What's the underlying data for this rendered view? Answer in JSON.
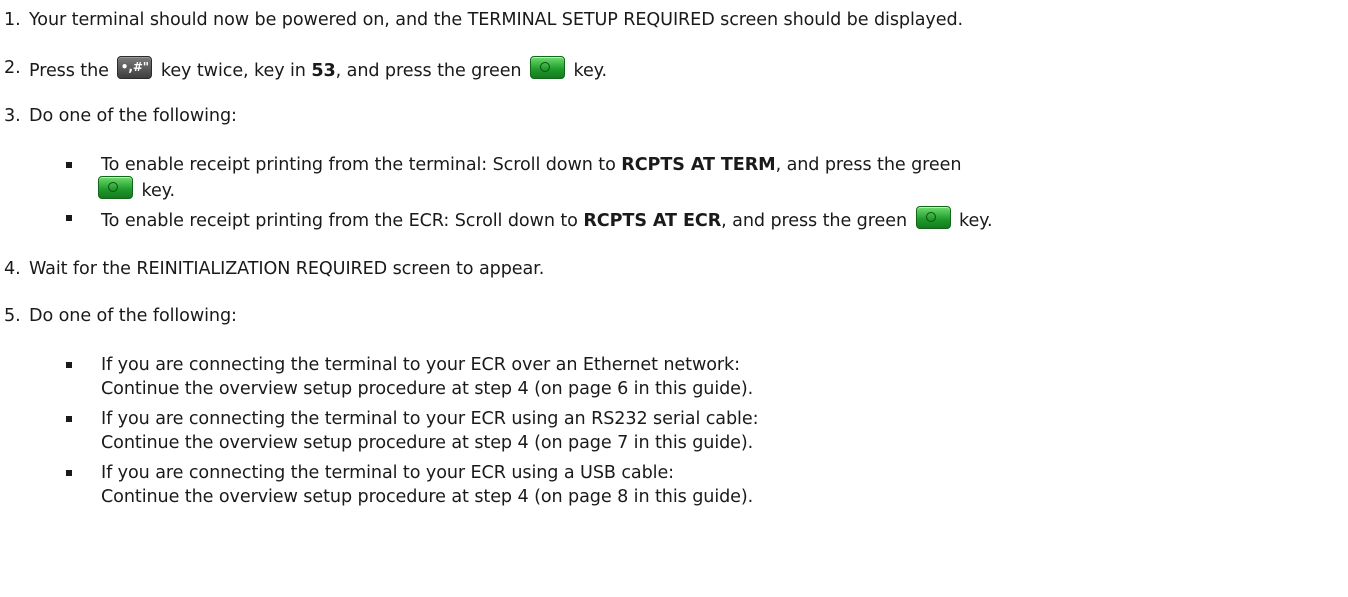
{
  "steps": [
    {
      "number": "1.",
      "text": "Your terminal should now be powered on, and the TERMINAL SETUP REQUIRED screen should be displayed."
    },
    {
      "number": "2.",
      "parts": {
        "a": "Press the",
        "b": "key twice, key in",
        "c": "53",
        "d": ", and press the green",
        "e": "key."
      },
      "hash_key_glyph": "•,#\"",
      "icons": [
        "hash-key-icon",
        "green-enter-key-icon"
      ]
    },
    {
      "number": "3.",
      "text": "Do one of the following:",
      "bullets": [
        {
          "line1": "To enable receipt printing from the terminal: Scroll down to",
          "bold": "RCPTS AT TERM",
          "after": ", and press the green",
          "line2": "key."
        },
        {
          "before": "To enable receipt printing from the ECR: Scroll down to",
          "bold": "RCPTS AT ECR",
          "after": ", and press the green",
          "end": "key."
        }
      ]
    },
    {
      "number": "4.",
      "text": "Wait for the REINITIALIZATION REQUIRED screen to appear."
    },
    {
      "number": "5.",
      "text": "Do one of the following:",
      "bullets": [
        {
          "line1": "If you are connecting the terminal to your ECR over an Ethernet network:",
          "line2": "Continue the overview setup procedure at step 4 (on page 6 in this guide)."
        },
        {
          "line1": "If you are connecting the terminal to your ECR using an RS232 serial cable:",
          "line2": "Continue the overview setup procedure at step 4 (on page 7 in this guide)."
        },
        {
          "line1": "If you are connecting the terminal to your ECR using a USB cable:",
          "line2": "Continue the overview setup procedure at step 4 (on page 8 in this guide)."
        }
      ]
    }
  ],
  "colors": {
    "text": "#1a1a1a",
    "green_key": "#1e9a2a",
    "hash_key": "#3e3e3e"
  }
}
